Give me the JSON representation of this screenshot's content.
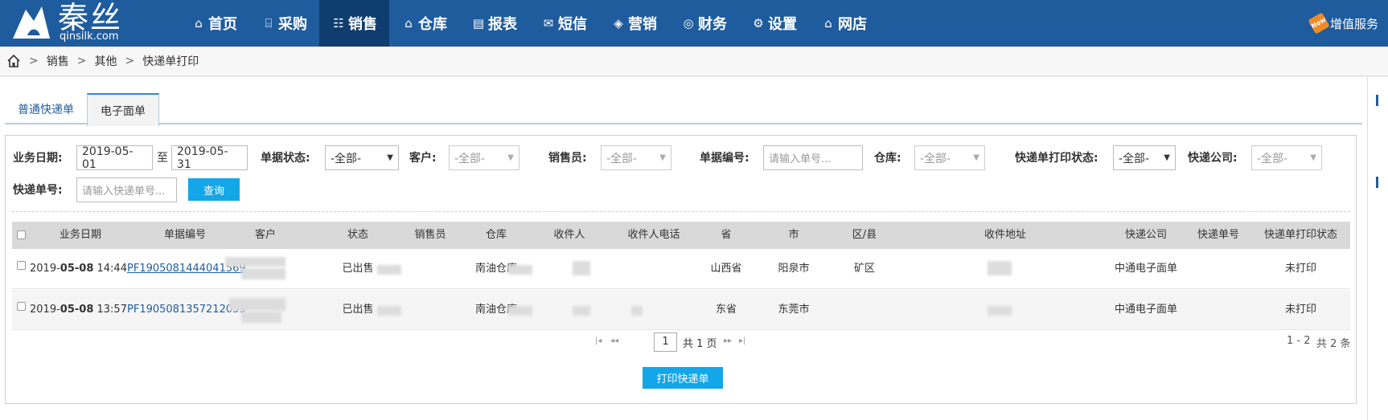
{
  "brand": {
    "name": "秦丝",
    "domain": "qinsilk.com"
  },
  "nav": [
    {
      "label": "首页",
      "icon": "home-icon",
      "glyph": "⌂"
    },
    {
      "label": "采购",
      "icon": "store-icon",
      "glyph": "⌸"
    },
    {
      "label": "销售",
      "icon": "users-icon",
      "glyph": "☷",
      "active": true
    },
    {
      "label": "仓库",
      "icon": "warehouse-icon",
      "glyph": "⌂"
    },
    {
      "label": "报表",
      "icon": "report-icon",
      "glyph": "▤"
    },
    {
      "label": "短信",
      "icon": "mail-icon",
      "glyph": "✉"
    },
    {
      "label": "营销",
      "icon": "tag-icon",
      "glyph": "◈"
    },
    {
      "label": "财务",
      "icon": "finance-icon",
      "glyph": "◎"
    },
    {
      "label": "设置",
      "icon": "settings-icon",
      "glyph": "⚙"
    },
    {
      "label": "网店",
      "icon": "shop-icon",
      "glyph": "⌂"
    }
  ],
  "value_added": {
    "badge": "New",
    "label": "增值服务"
  },
  "breadcrumb": {
    "sep": ">",
    "items": [
      "销售",
      "其他",
      "快递单打印"
    ]
  },
  "tabs": [
    {
      "label": "普通快递单",
      "active": false
    },
    {
      "label": "电子面单",
      "active": true
    }
  ],
  "filters": {
    "date_label": "业务日期:",
    "date_from": "2019-05-01",
    "date_to_sep": "至",
    "date_to": "2019-05-31",
    "status_label": "单据状态:",
    "status_value": "-全部-",
    "customer_label": "客户:",
    "customer_value": "-全部-",
    "seller_label": "销售员:",
    "seller_value": "-全部-",
    "docno_label": "单据编号:",
    "docno_placeholder": "请输入单号...",
    "warehouse_label": "仓库:",
    "warehouse_value": "-全部-",
    "print_status_label": "快递单打印状态:",
    "print_status_value": "-全部-",
    "express_company_label": "快递公司:",
    "express_company_value": "-全部-",
    "express_no_label": "快递单号:",
    "express_no_placeholder": "请输入快递单号...",
    "query_button": "查询"
  },
  "table": {
    "columns": [
      "业务日期",
      "单据编号",
      "客户",
      "状态",
      "销售员",
      "仓库",
      "收件人",
      "收件人电话",
      "省",
      "市",
      "区/县",
      "收件地址",
      "快递公司",
      "快递单号",
      "快递单打印状态"
    ],
    "rows": [
      {
        "date_prefix": "2019-",
        "date_bold": "05-08",
        "time": "14:44",
        "doc_no": "PF1905081444041569",
        "status": "已出售",
        "warehouse": "南油仓库",
        "province": "山西省",
        "city": "阳泉市",
        "district": "矿区",
        "express_company": "中通电子面单",
        "express_no": "",
        "print_status": "未打印"
      },
      {
        "date_prefix": "2019-",
        "date_bold": "05-08",
        "time": "13:57",
        "doc_no": "PF1905081357212059",
        "status": "已出售",
        "warehouse": "南油仓库",
        "province": "东省",
        "city": "东莞市",
        "district": "",
        "express_company": "中通电子面单",
        "express_no": "",
        "print_status": "未打印"
      }
    ]
  },
  "pager": {
    "first": "|◂",
    "prev": "◂◂",
    "page": "1",
    "total_pages_text": "共 1 页",
    "next": "▸▸",
    "last": "▸|",
    "range_text": "1 - 2",
    "total_text": "共 2 条"
  },
  "print_button": "打印快递单",
  "colors": {
    "nav_bg": "#1f5c9e",
    "nav_active": "#0f3d6e",
    "accent": "#13a6e8"
  }
}
